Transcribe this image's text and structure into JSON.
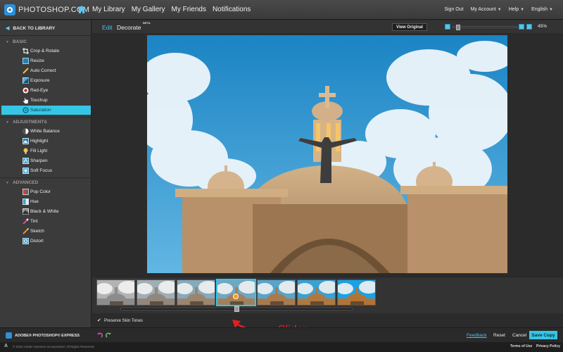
{
  "app": {
    "logo_text": "PHOTOSHOP.COM"
  },
  "nav": {
    "items": [
      "My Library",
      "My Gallery",
      "My Friends",
      "Notifications"
    ]
  },
  "top_right": {
    "sign_out": "Sign Out",
    "my_account": "My Account",
    "help": "Help",
    "language": "English"
  },
  "sidebar": {
    "back_label": "BACK TO LIBRARY",
    "sections": [
      {
        "label": "BASIC",
        "items": [
          {
            "label": "Crop & Rotate",
            "icon": "crop-icon"
          },
          {
            "label": "Resize",
            "icon": "resize-icon"
          },
          {
            "label": "Auto Correct",
            "icon": "wand-icon"
          },
          {
            "label": "Exposure",
            "icon": "exposure-icon"
          },
          {
            "label": "Red-Eye",
            "icon": "eye-icon"
          },
          {
            "label": "Touchup",
            "icon": "hand-icon"
          },
          {
            "label": "Saturation",
            "icon": "saturation-icon",
            "active": true
          }
        ]
      },
      {
        "label": "ADJUSTMENTS",
        "items": [
          {
            "label": "White Balance",
            "icon": "white-balance-icon"
          },
          {
            "label": "Highlight",
            "icon": "highlight-icon"
          },
          {
            "label": "Fill Light",
            "icon": "bulb-icon"
          },
          {
            "label": "Sharpen",
            "icon": "sharpen-icon"
          },
          {
            "label": "Soft Focus",
            "icon": "soft-focus-icon"
          }
        ]
      },
      {
        "label": "ADVANCED",
        "items": [
          {
            "label": "Pop Color",
            "icon": "pop-color-icon"
          },
          {
            "label": "Hue",
            "icon": "hue-icon"
          },
          {
            "label": "Black & White",
            "icon": "black-white-icon"
          },
          {
            "label": "Tint",
            "icon": "tint-icon"
          },
          {
            "label": "Sketch",
            "icon": "sketch-icon"
          },
          {
            "label": "Distort",
            "icon": "distort-icon"
          }
        ]
      }
    ]
  },
  "editor": {
    "tab_edit": "Edit",
    "tab_decorate": "Decorate",
    "beta": "BETA",
    "view_original": "View Original",
    "zoom": "45%",
    "zoom_level": 0.05
  },
  "filmstrip": {
    "thumb_count": 7,
    "selected_index": 3,
    "slider_value": 0.5,
    "preserve_label": "Preserve Skin Tones"
  },
  "annotation": {
    "label": "Slider",
    "color": "#e02020"
  },
  "actions": {
    "feedback": "Feedback",
    "reset": "Reset",
    "cancel": "Cancel",
    "save": "Save Copy"
  },
  "bottom": {
    "express_label": "ADOBE® PHOTOSHOP® EXPRESS"
  },
  "footer": {
    "copyright": "© 2010 Adobe Systems Incorporated. All Rights Reserved.",
    "terms": "Terms of Use",
    "privacy": "Privacy Policy"
  },
  "colors": {
    "accent": "#35c6e6",
    "link": "#4fc0ea",
    "annotation": "#e02020"
  }
}
